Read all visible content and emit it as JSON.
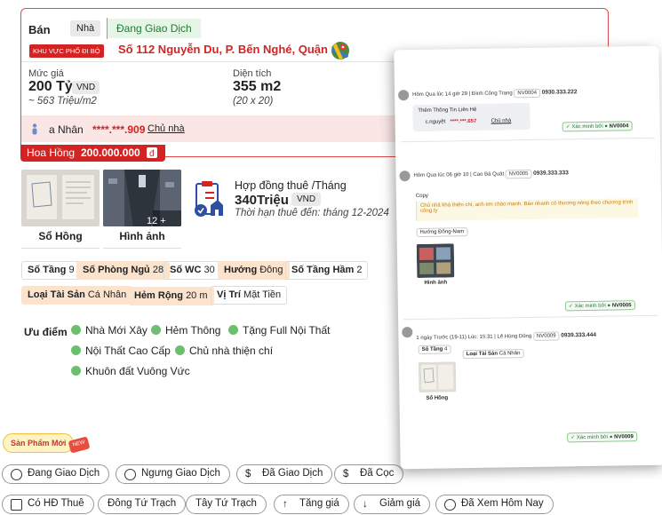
{
  "listing": {
    "type_label": "Bán",
    "property_type": "Nhà",
    "status": "Đang Giao Dịch",
    "zone_badge": "KHU VỰC PHỐ ĐI BỘ",
    "address": "Số 112 Nguyễn Du, P. Bến Nghé, Quận 1",
    "map_icon": "google-maps-icon",
    "price_label": "Mức giá",
    "price_value": "200 Tỷ",
    "price_unit": "VND",
    "price_per_m2": "~ 563 Triệu/m2",
    "area_label": "Diện tích",
    "area_value": "355 m2",
    "area_dims": "(20 x 20)",
    "owner_name": "a Nhân",
    "owner_phone": "****.***.909",
    "owner_role": "Chủ nhà",
    "commission_label": "Hoa Hồng",
    "commission_value": "200.000.000"
  },
  "media": {
    "thumb1_label": "Sổ Hồng",
    "thumb2_label": "Hình ảnh",
    "photo_count": "12 +"
  },
  "lease": {
    "title": "Hợp đồng thuê /Tháng",
    "value": "340Triệu",
    "unit": "VND",
    "term": "Thời hạn thuê đến: tháng 12-2024"
  },
  "specs": [
    {
      "label": "Số Tầng",
      "value": "9"
    },
    {
      "label": "Số Phòng Ngủ",
      "value": "28"
    },
    {
      "label": "Số WC",
      "value": "30"
    },
    {
      "label": "Hướng",
      "value": "Đông"
    },
    {
      "label": "Số Tầng Hầm",
      "value": "2"
    },
    {
      "label": "Loại Tài Sản",
      "value": "Cá Nhân"
    },
    {
      "label": "Hẻm Rộng",
      "value": "20 m"
    },
    {
      "label": "Vị Trí",
      "value": "Mặt Tiền"
    }
  ],
  "advantages": {
    "label": "Ưu điểm",
    "items": [
      "Nhà Mới Xây",
      "Hẻm Thông",
      "Tặng Full Nội Thất",
      "Nội Thất Cao Cấp",
      "Chủ nhà thiện chí",
      "Khuôn đất Vuông Vức"
    ]
  },
  "new_badge": "Sản Phẩm Mới",
  "new_tag": "NEW",
  "buttons": [
    "Đang Giao Dịch",
    "Ngưng Giao Dịch",
    "Đã Giao Dịch",
    "Đã Cọc",
    "Có HĐ Thuê",
    "Đông Tứ Trạch",
    "Tây Tứ Trạch",
    "Tăng giá",
    "Giảm giá",
    "Đã Xem Hôm Nay"
  ],
  "activity": [
    {
      "time": "Hôm Qua lúc 14 giờ 29",
      "agent": "Đình Công Trang",
      "code": "NV0004",
      "phone": "0930.333.222",
      "box_title": "Thêm Thông Tin Liên Hệ",
      "contact_name": "c.nguyệt",
      "contact_phone": "****.***.657",
      "contact_role": "Chủ nhà",
      "verified_label": "Xác minh bởi",
      "verified_code": "NV0004"
    },
    {
      "time": "Hôm Qua lúc 06 giờ 10",
      "agent": "Cao Bá Quát",
      "code": "NV0005",
      "phone": "0939.333.333",
      "copy_label": "Copy",
      "note": "Chủ nhà khá thiện chí, anh em chào mạnh. Bán nhanh có thương nóng theo chương trình công ty",
      "direction_chip": "Hướng Đông-Nam",
      "image_caption": "Hình ảnh",
      "verified_label": "Xác minh bởi",
      "verified_code": "NV0005"
    },
    {
      "time": "1 ngày Trước (19-11) Lúc: 15:31",
      "agent": "Lê Hùng Dũng",
      "code": "NV0009",
      "phone": "0939.333.444",
      "chip1_label": "Số Tầng",
      "chip1_value": "4",
      "chip2_label": "Loại Tài Sản",
      "chip2_value": "Cá Nhân",
      "image_caption": "Sổ Hồng",
      "verified_label": "Xác minh bởi",
      "verified_code": "NV0009"
    }
  ],
  "colors": {
    "primary_red": "#d32323",
    "status_green": "#1e7a30",
    "peach": "#fbe3cd",
    "owner_band": "#fbe6e6"
  }
}
